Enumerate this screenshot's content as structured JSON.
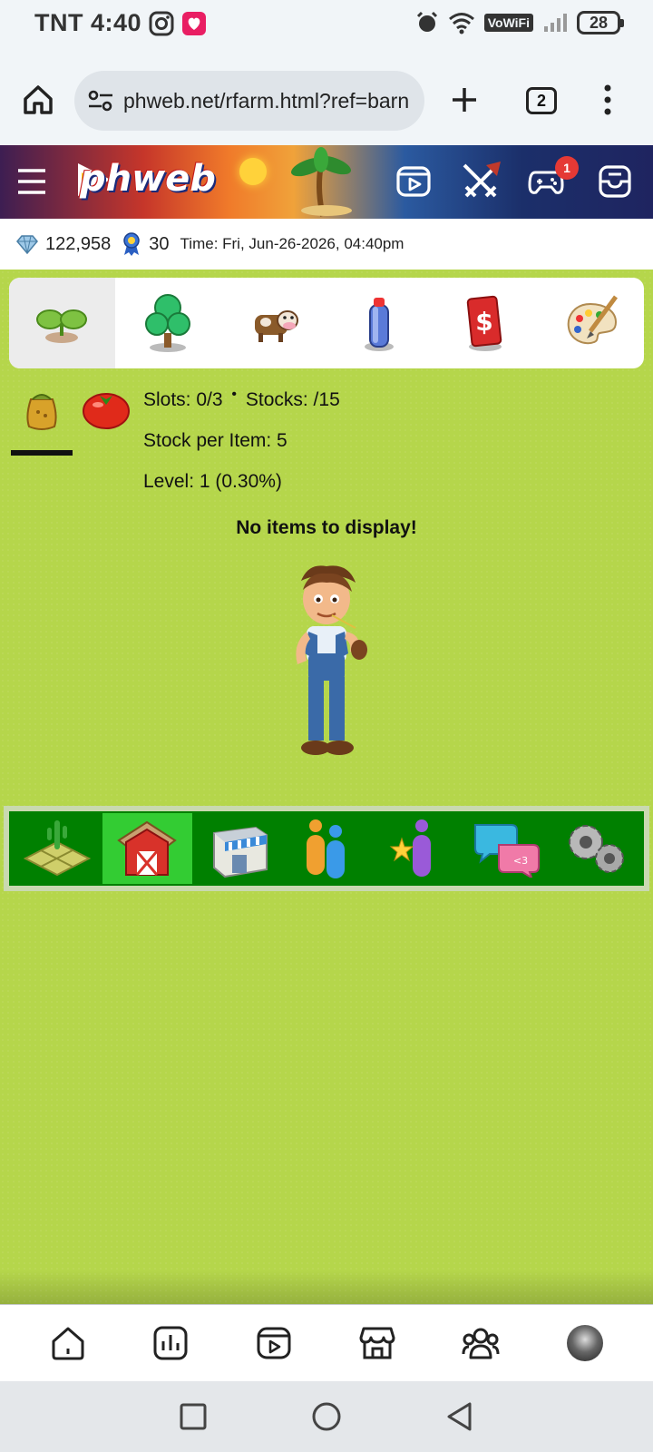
{
  "status_bar": {
    "carrier_time": "TNT 4:40",
    "vowifi": "VoWiFi",
    "battery": "28",
    "icons": [
      "instagram-icon",
      "lazada-icon",
      "alarm-icon",
      "wifi-icon",
      "signal-icon"
    ]
  },
  "browser": {
    "url": "phweb.net/rfarm.html?ref=barn",
    "tab_count": "2"
  },
  "site_header": {
    "logo": "phweb",
    "notification_count": "1",
    "icons": [
      "menu-icon",
      "video-icon",
      "battle-icon",
      "game-controller-icon",
      "inbox-icon"
    ]
  },
  "info": {
    "diamonds": "122,958",
    "level_badge": "30",
    "time": "Time: Fri, Jun-26-2026, 04:40pm"
  },
  "category_tabs": [
    {
      "name": "seeds-tab",
      "icon": "sprout-icon",
      "active": true
    },
    {
      "name": "trees-tab",
      "icon": "tree-icon",
      "active": false
    },
    {
      "name": "animals-tab",
      "icon": "cow-icon",
      "active": false
    },
    {
      "name": "products-tab",
      "icon": "bottle-icon",
      "active": false
    },
    {
      "name": "cash-tab",
      "icon": "dollar-icon",
      "active": false
    },
    {
      "name": "decor-tab",
      "icon": "palette-icon",
      "active": false
    }
  ],
  "inventory": {
    "slots": "Slots: 0/3",
    "bullet": "•",
    "stocks": "Stocks: /15",
    "stock_per_item": "Stock per Item: 5",
    "level": "Level: 1 (0.30%)",
    "empty_message": "No items to display!"
  },
  "game_nav": [
    {
      "name": "farm-nav",
      "icon": "farm-plot-icon",
      "active": false
    },
    {
      "name": "barn-nav",
      "icon": "barn-icon",
      "active": true
    },
    {
      "name": "shop-nav",
      "icon": "shop-icon",
      "active": false
    },
    {
      "name": "neighbors-nav",
      "icon": "people-icon",
      "active": false
    },
    {
      "name": "achievements-nav",
      "icon": "star-person-icon",
      "active": false
    },
    {
      "name": "chat-nav",
      "icon": "chat-icon",
      "active": false
    },
    {
      "name": "settings-nav",
      "icon": "gears-icon",
      "active": false
    }
  ],
  "app_nav": [
    "home-icon",
    "stats-icon",
    "reels-icon",
    "market-icon",
    "groups-icon",
    "profile-avatar"
  ],
  "colors": {
    "grass": "#b5d64b",
    "game_nav_bg": "#008000",
    "game_nav_active": "#33cc33",
    "notification": "#e53935"
  }
}
